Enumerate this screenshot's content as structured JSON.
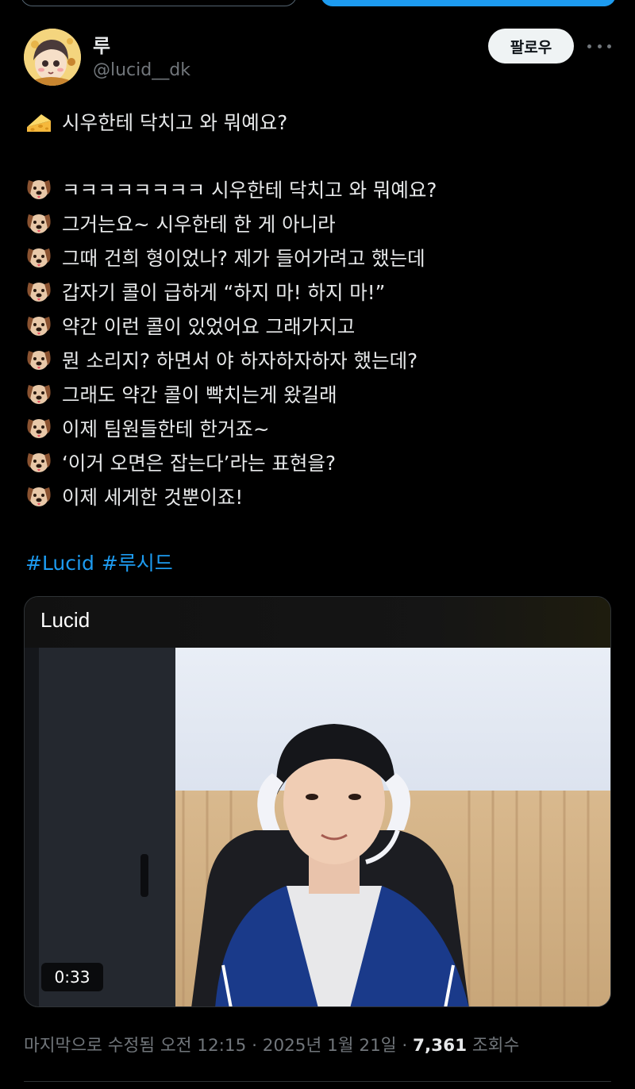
{
  "author": {
    "name": "루",
    "handle": "@lucid__dk"
  },
  "follow_label": "팔로우",
  "tweet": {
    "intro_line": "시우한테 닥치고 와 뭐예요?",
    "lines": [
      "ㅋㅋㅋㅋㅋㅋㅋㅋ 시우한테 닥치고 와 뭐예요?",
      "그거는요~ 시우한테 한 게 아니라",
      "그때 건희 형이었나? 제가 들어가려고 했는데",
      "갑자기 콜이 급하게 “하지 마! 하지 마!”",
      "약간 이런 콜이 있었어요 그래가지고",
      "뭔 소리지? 하면서 야 하자하자하자 했는데?",
      "그래도 약간 콜이 빡치는게 왔길래",
      "이제 팀원들한테 한거죠~",
      "‘이거 오면은 잡는다’라는 표현을?",
      "이제 세게한 것뿐이죠!"
    ],
    "hashtags": [
      "#Lucid",
      "#루시드"
    ],
    "intro_icon": "cheese-icon",
    "line_icon": "dog-face-icon"
  },
  "media": {
    "title": "Lucid",
    "duration": "0:33"
  },
  "meta": {
    "edited_text": "마지막으로 수정됨 오전 12:15 · 2025년 1월 21일 · ",
    "views_count": "7,361",
    "views_label": " 조회수"
  },
  "colors": {
    "background": "#000000",
    "accent": "#1d9bf0",
    "secondary_text": "#71767b"
  }
}
